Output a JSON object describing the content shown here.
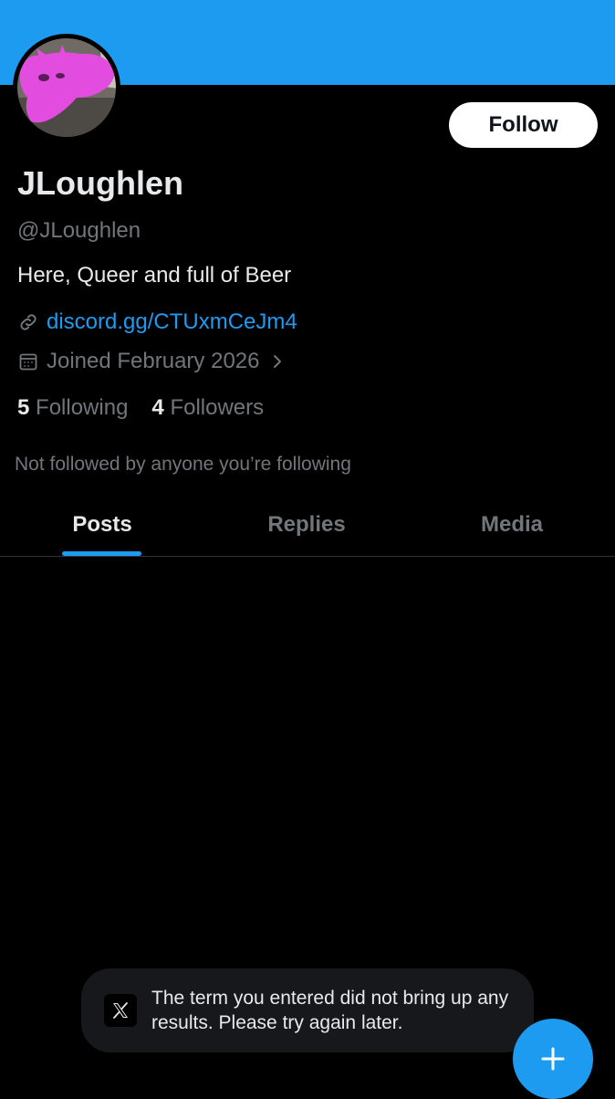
{
  "colors": {
    "banner": "#1d9bf0",
    "accent": "#1d9bf0",
    "background": "#000000",
    "primary_text": "#e7e9ea",
    "secondary_text": "#71767b",
    "avatar_tint": "#e24ddf"
  },
  "profile": {
    "display_name": "JLoughlen",
    "handle": "@JLoughlen",
    "bio": "Here, Queer and full of Beer",
    "link": "discord.gg/CTUxmCeJm4",
    "link_icon": "link-icon",
    "joined": "Joined February 2026",
    "joined_icon": "calendar-icon",
    "follow_label": "Follow",
    "following_count": "5",
    "following_label": "Following",
    "followers_count": "4",
    "followers_label": "Followers",
    "not_followed_text": "Not followed by anyone you’re following"
  },
  "tabs": [
    {
      "label": "Posts",
      "active": true
    },
    {
      "label": "Replies",
      "active": false
    },
    {
      "label": "Media",
      "active": false
    }
  ],
  "toast": {
    "icon": "x-logo-icon",
    "message": "The term you entered did not bring up any results. Please try again later."
  },
  "fab": {
    "icon": "plus-icon"
  }
}
